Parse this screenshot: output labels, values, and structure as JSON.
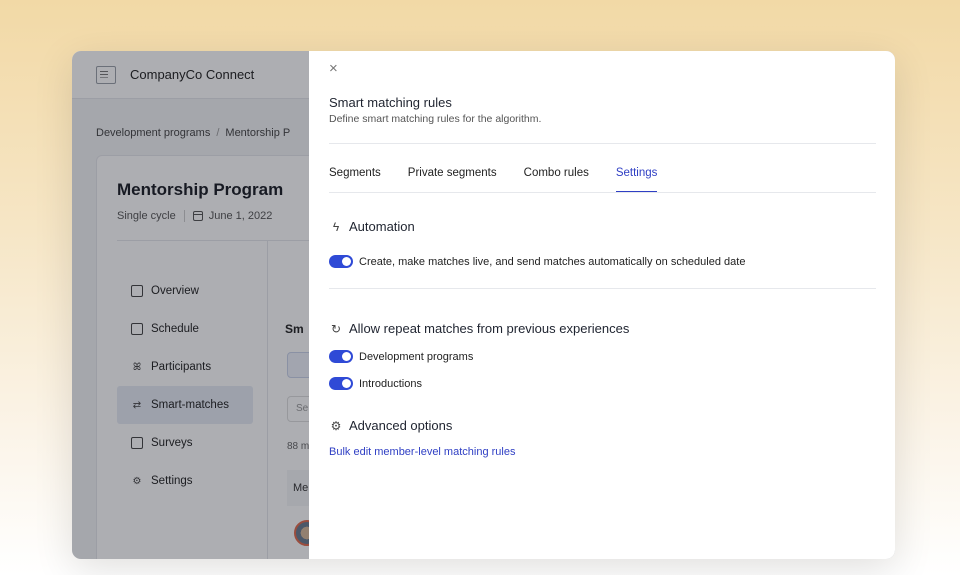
{
  "app": {
    "title": "CompanyCo Connect"
  },
  "breadcrumb": {
    "items": [
      "Development programs",
      "Mentorship P"
    ]
  },
  "program": {
    "title": "Mentorship Program",
    "cycle": "Single cycle",
    "date": "June 1, 2022"
  },
  "nav": {
    "items": [
      {
        "label": "Overview",
        "icon": "chart-icon"
      },
      {
        "label": "Schedule",
        "icon": "calendar-icon"
      },
      {
        "label": "Participants",
        "icon": "people-icon"
      },
      {
        "label": "Smart-matches",
        "icon": "swap-icon",
        "active": true
      },
      {
        "label": "Surveys",
        "icon": "survey-icon"
      },
      {
        "label": "Settings",
        "icon": "gear-icon"
      }
    ]
  },
  "behind": {
    "heading": "Sm",
    "input_placeholder": "Se",
    "count": "88 m",
    "column": "Me"
  },
  "drawer": {
    "close": "×",
    "title": "Smart matching rules",
    "subtitle": "Define smart matching rules for the algorithm.",
    "tabs": [
      "Segments",
      "Private segments",
      "Combo rules",
      "Settings"
    ],
    "active_tab": "Settings",
    "automation": {
      "heading": "Automation",
      "toggle_label": "Create, make matches live, and send matches automatically on scheduled date",
      "enabled": true
    },
    "repeat": {
      "heading": "Allow repeat matches from previous experiences",
      "options": [
        {
          "label": "Development programs",
          "enabled": true
        },
        {
          "label": "Introductions",
          "enabled": true
        }
      ]
    },
    "advanced": {
      "heading": "Advanced options",
      "link": "Bulk edit member-level matching rules"
    }
  },
  "colors": {
    "accent": "#2f3fc4",
    "toggle": "#2f4ad6"
  }
}
